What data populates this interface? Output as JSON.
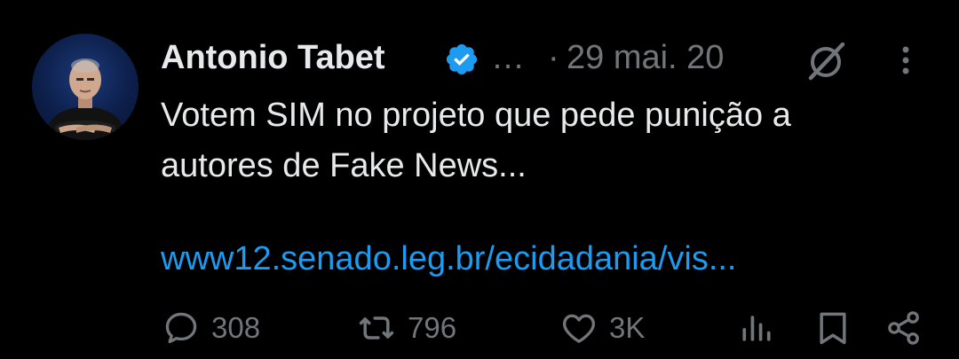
{
  "theme": {
    "background": "#000000",
    "text_primary": "#e7e9ea",
    "text_secondary": "#71767b",
    "link": "#1d9bf0",
    "verified_badge": "#1d9bf0"
  },
  "tweet": {
    "author": {
      "name": "Antonio Tabet",
      "verified_icon": "verified-badge-icon",
      "truncation": "…"
    },
    "separator": "·",
    "timestamp": "29 mai. 20",
    "header_icons": [
      "grok-icon",
      "more-options-icon"
    ],
    "text": "Votem SIM no projeto que pede punição a\nautores de Fake News...",
    "link_text": "www12.senado.leg.br/ecidadania/vis..."
  },
  "actions": {
    "reply": {
      "icon": "reply-icon",
      "count": "308"
    },
    "repost": {
      "icon": "repost-icon",
      "count": "796"
    },
    "like": {
      "icon": "like-icon",
      "count": "3K"
    },
    "views": {
      "icon": "views-icon"
    },
    "bookmark": {
      "icon": "bookmark-icon"
    },
    "share": {
      "icon": "share-icon"
    }
  }
}
